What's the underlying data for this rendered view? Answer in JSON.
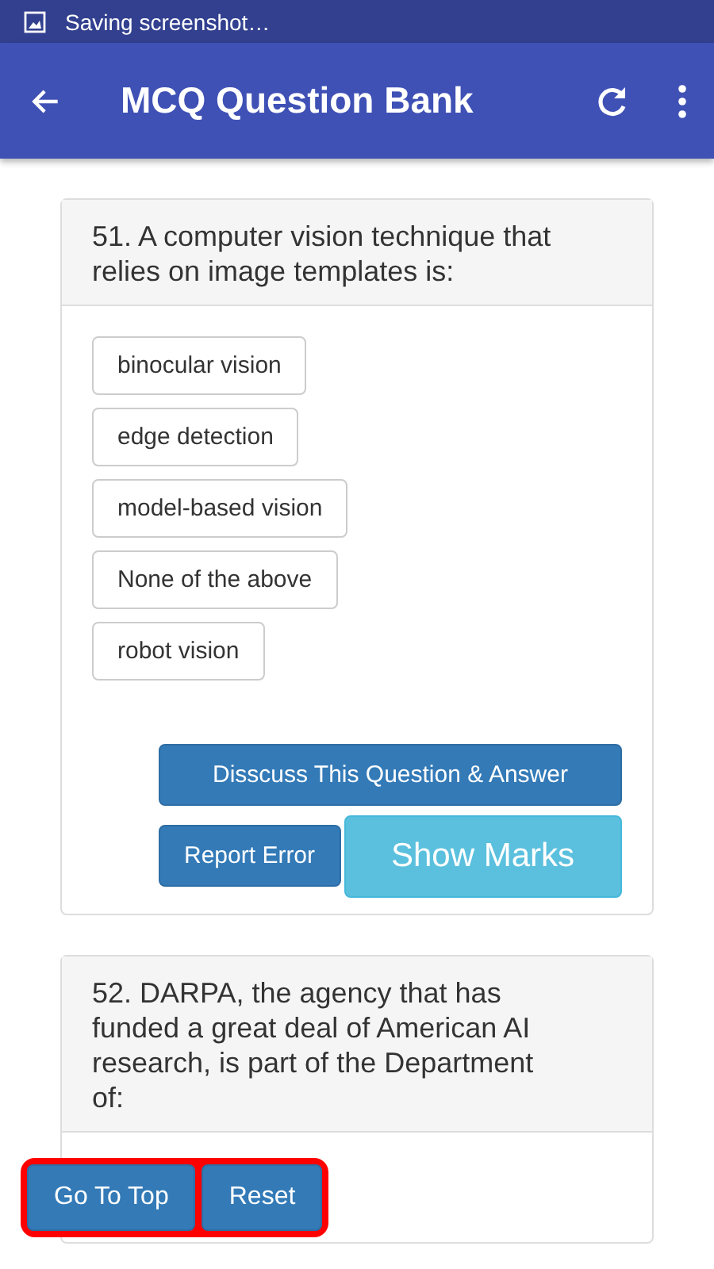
{
  "status_bar": {
    "notification": "Saving screenshot…"
  },
  "app_bar": {
    "title": "MCQ Question Bank"
  },
  "questions": [
    {
      "text": "51. A computer vision technique that relies on image templates is:",
      "options": [
        "binocular vision",
        "edge detection",
        "model-based vision",
        "None of the above",
        "robot vision"
      ],
      "discuss_button": "Disscuss This Question & Answer",
      "report_button": "Report Error",
      "marks_button": "Show Marks"
    },
    {
      "text": "52. DARPA, the agency that has funded a great deal of American AI research, is part of the Department of:"
    }
  ],
  "floating_buttons": [
    "Go To Top",
    "Reset"
  ]
}
